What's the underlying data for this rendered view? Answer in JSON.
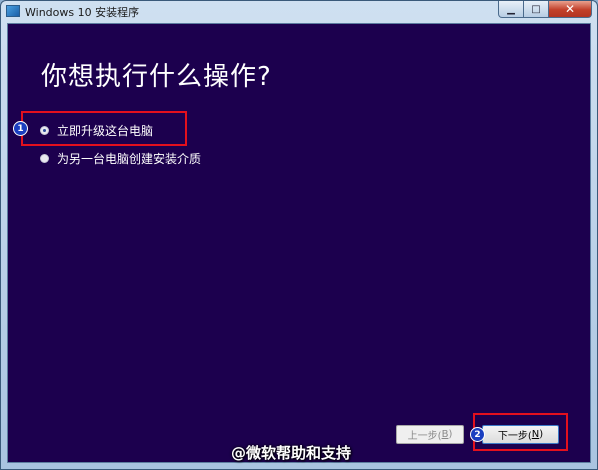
{
  "window": {
    "title": "Windows 10 安装程序",
    "close_symbol": "✕",
    "minimize_symbol": "▁",
    "maximize_symbol": "□"
  },
  "main": {
    "heading": "你想执行什么操作?",
    "options": [
      {
        "label": "立即升级这台电脑",
        "selected": true
      },
      {
        "label": "为另一台电脑创建安装介质",
        "selected": false
      }
    ]
  },
  "buttons": {
    "back_label": "上一步(",
    "back_key": "B",
    "back_end": ")",
    "next_label": "下一步(",
    "next_key": "N",
    "next_end": ")"
  },
  "annotations": {
    "badge1": "1",
    "badge2": "2",
    "highlight_color": "#e3101d"
  },
  "watermark": "@微软帮助和支持",
  "colors": {
    "background": "#1c004e",
    "badge": "#1a3fc0"
  },
  "icons": {
    "title": "windows-setup-icon"
  }
}
